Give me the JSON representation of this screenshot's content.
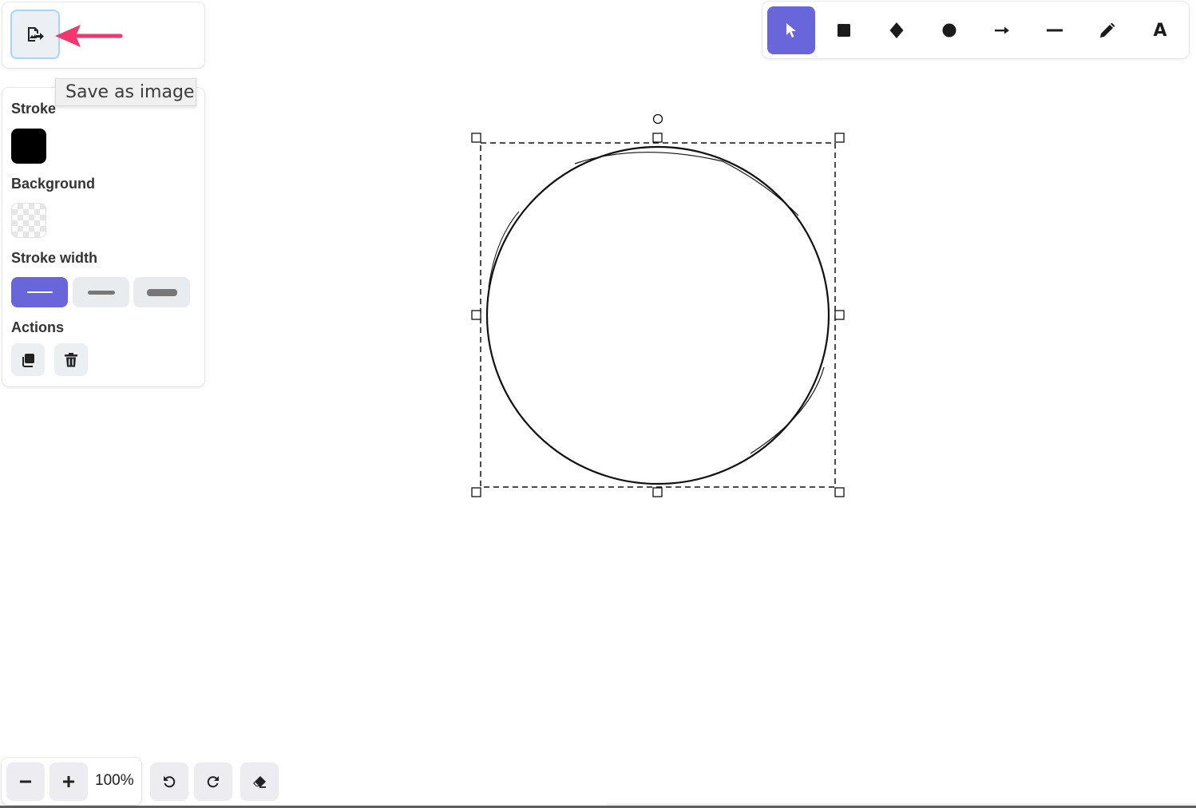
{
  "export": {
    "button_icon": "export-image-icon",
    "tooltip": "Save as image",
    "annotation_color": "#f0376e"
  },
  "properties": {
    "stroke_label": "Stroke",
    "stroke_color": "#000000",
    "background_label": "Background",
    "background_value": "transparent",
    "stroke_width_label": "Stroke width",
    "stroke_widths": [
      {
        "name": "thin",
        "active": true
      },
      {
        "name": "medium",
        "active": false
      },
      {
        "name": "thick",
        "active": false
      }
    ],
    "actions_label": "Actions",
    "actions": [
      {
        "name": "duplicate",
        "icon": "duplicate-icon"
      },
      {
        "name": "delete",
        "icon": "trash-icon"
      }
    ]
  },
  "toolbar": {
    "tools": [
      {
        "name": "select",
        "icon": "pointer-icon",
        "active": true
      },
      {
        "name": "rectangle",
        "icon": "square-icon",
        "active": false
      },
      {
        "name": "diamond",
        "icon": "diamond-icon",
        "active": false
      },
      {
        "name": "ellipse",
        "icon": "circle-icon",
        "active": false
      },
      {
        "name": "arrow",
        "icon": "arrow-icon",
        "active": false
      },
      {
        "name": "line",
        "icon": "line-icon",
        "active": false
      },
      {
        "name": "draw",
        "icon": "pencil-icon",
        "active": false
      },
      {
        "name": "text",
        "icon": "text-icon",
        "label": "A",
        "active": false
      }
    ],
    "accent_color": "#6965db"
  },
  "canvas": {
    "selected_element": "ellipse"
  },
  "footer": {
    "zoom_level": "100%",
    "buttons": [
      {
        "name": "zoom-out",
        "icon": "minus-icon"
      },
      {
        "name": "zoom-in",
        "icon": "plus-icon"
      },
      {
        "name": "undo",
        "icon": "undo-icon"
      },
      {
        "name": "redo",
        "icon": "redo-icon"
      },
      {
        "name": "clear-canvas",
        "icon": "eraser-icon"
      }
    ]
  }
}
